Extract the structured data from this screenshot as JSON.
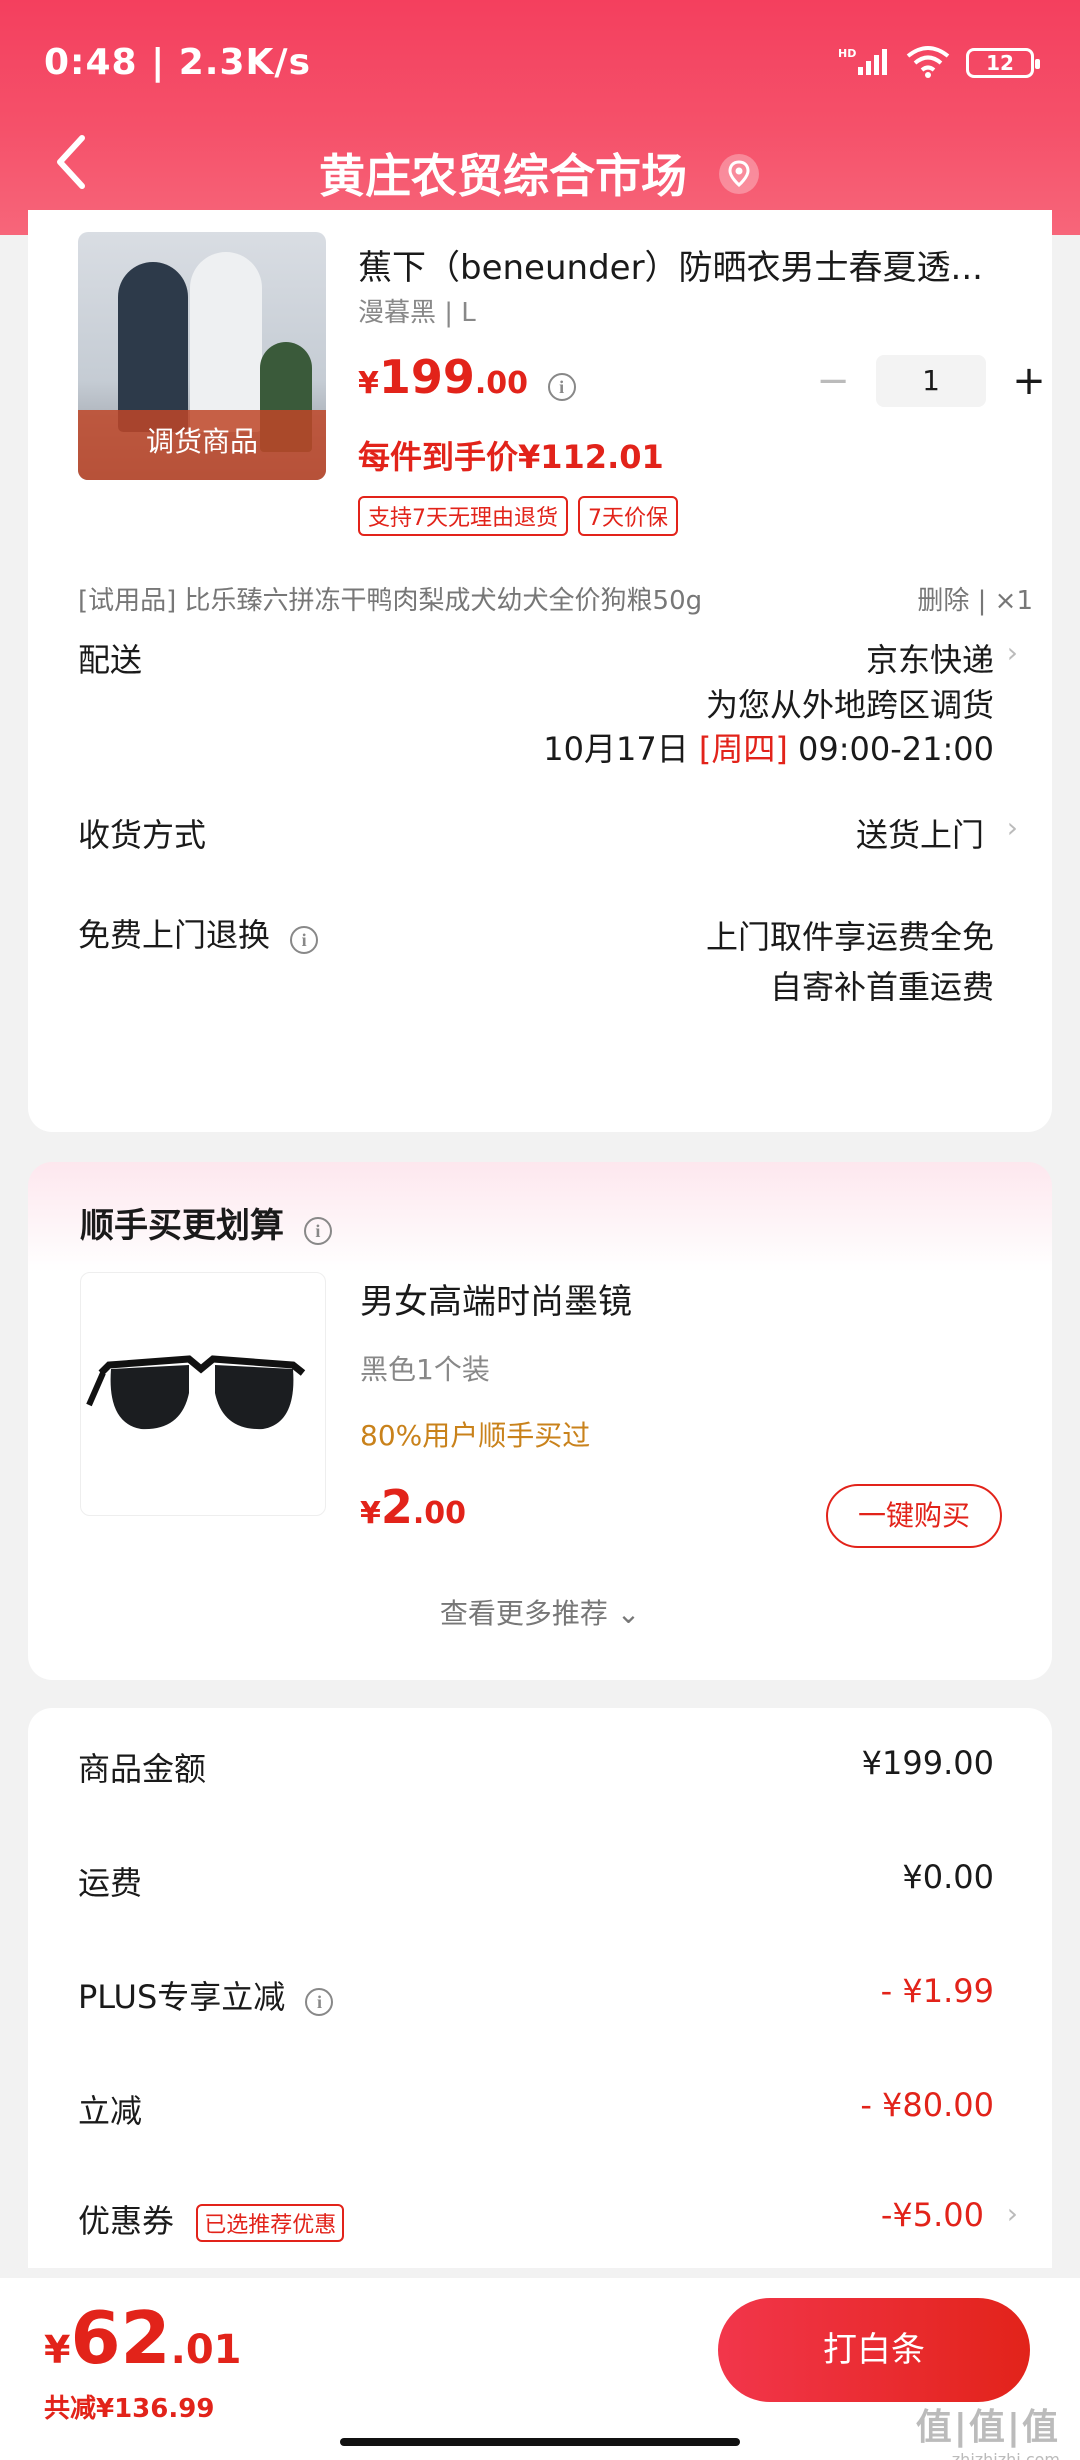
{
  "status_bar": {
    "time_speed": "0:48 | 2.3K/s",
    "battery": "12",
    "network": "HD"
  },
  "header": {
    "title": "黄庄农贸综合市场"
  },
  "product": {
    "image_tag": "调货商品",
    "name": "蕉下（beneunder）防晒衣男士春夏透...",
    "spec": "漫暮黑 | L",
    "price_symbol": "¥",
    "price_int": "199",
    "price_dec": ".00",
    "quantity": "1",
    "unit_price": "每件到手价¥112.01",
    "badges": [
      "支持7天无理由退货",
      "7天价保"
    ]
  },
  "gift": {
    "text": "[试用品]  比乐臻六拼冻干鸭肉梨成犬幼犬全价狗粮50g",
    "actions": "删除 | ×1"
  },
  "delivery": {
    "label": "配送",
    "carrier": "京东快递",
    "note": "为您从外地跨区调货",
    "date": "10月17日",
    "weekday": "[周四]",
    "time": "09:00-21:00"
  },
  "receive": {
    "label": "收货方式",
    "value": "送货上门"
  },
  "returns": {
    "label": "免费上门退换",
    "line1": "上门取件享运费全免",
    "line2": "自寄补首重运费"
  },
  "recommend": {
    "title": "顺手买更划算",
    "name": "男女高端时尚墨镜",
    "spec": "黑色1个装",
    "note": "80%用户顺手买过",
    "price_symbol": "¥",
    "price_int": "2",
    "price_dec": ".00",
    "buy_label": "一键购买",
    "more_label": "查看更多推荐 ⌄"
  },
  "summary": {
    "rows": [
      {
        "label": "商品金额",
        "value": "¥199.00"
      },
      {
        "label": "运费",
        "value": "¥0.00"
      },
      {
        "label": "PLUS专享立减",
        "value": "- ¥1.99"
      },
      {
        "label": "立减",
        "value": "- ¥80.00"
      },
      {
        "label": "优惠券",
        "value": "-¥5.00"
      }
    ],
    "coupon_tag": "已选推荐优惠"
  },
  "bottom": {
    "price_symbol": "¥",
    "total_int": "62",
    "total_dec": ".01",
    "saved": "共减¥136.99",
    "pay_label": "打白条"
  },
  "watermark": {
    "big": "值|值|值",
    "small": "zhizhizhi.com"
  },
  "colors": {
    "accent": "#e2231a",
    "header": "#f43f5e"
  }
}
